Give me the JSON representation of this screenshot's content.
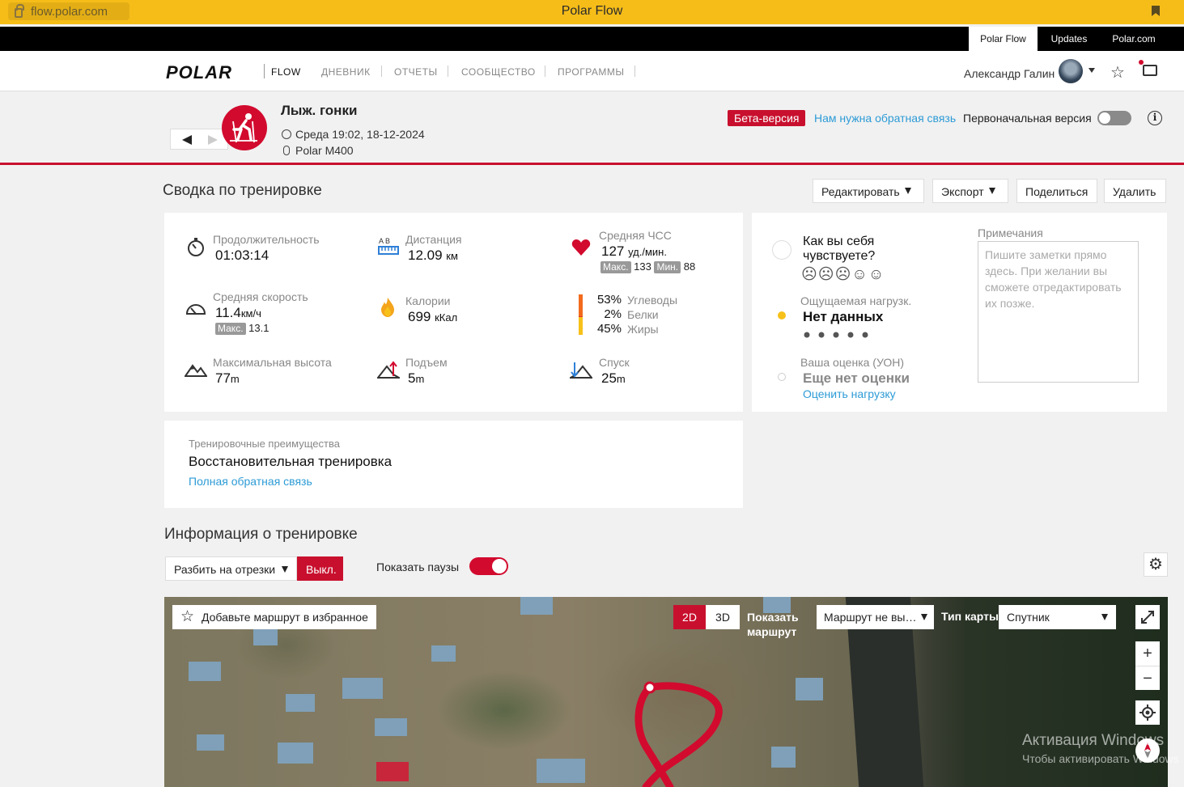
{
  "browser": {
    "url": "flow.polar.com",
    "title": "Polar Flow"
  },
  "topbar": {
    "tabs": [
      "Polar Flow",
      "Updates",
      "Polar.com"
    ]
  },
  "nav": {
    "logo": "POLAR",
    "logo_sub": "FLOW",
    "links": [
      "ДНЕВНИК",
      "ОТЧЕТЫ",
      "СООБЩЕСТВО",
      "ПРОГРАММЫ"
    ],
    "user": "Александр Галин"
  },
  "header": {
    "sport": "Лыж. гонки",
    "datetime": "Среда 19:02, 18-12-2024",
    "device": "Polar M400",
    "beta": "Бета-версия",
    "feedback": "Нам нужна обратная связь",
    "original_version": "Первоначальная версия",
    "info": "i"
  },
  "summary": {
    "title": "Сводка по тренировке",
    "buttons": {
      "edit": "Редактировать",
      "export": "Экспорт",
      "share": "Поделиться",
      "delete": "Удалить"
    },
    "duration": {
      "label": "Продолжительность",
      "value": "01:03:14"
    },
    "distance": {
      "label": "Дистанция",
      "value": "12.09",
      "unit": "км",
      "icon_text": "A B"
    },
    "hr": {
      "label": "Средняя ЧСС",
      "value": "127",
      "unit": "уд./мин.",
      "max_tag": "Макс.",
      "max": "133",
      "min_tag": "Мин.",
      "min": "88"
    },
    "speed": {
      "label": "Средняя скорость",
      "value": "11.4",
      "unit": "км/ч",
      "max_tag": "Макс.",
      "max": "13.1"
    },
    "calories": {
      "label": "Калории",
      "value": "699",
      "unit": "кКал"
    },
    "nutrition": [
      {
        "pct": "53%",
        "name": "Углеводы",
        "fill": 0.53,
        "color": "#f26b1d"
      },
      {
        "pct": "2%",
        "name": "Белки",
        "fill": 0.02,
        "color": "#e03a2e"
      },
      {
        "pct": "45%",
        "name": "Жиры",
        "fill": 0.45,
        "color": "#f7c11a"
      }
    ],
    "altitude": {
      "label": "Максимальная высота",
      "value": "77",
      "unit": "m"
    },
    "ascent": {
      "label": "Подъем",
      "value": "5",
      "unit": "m"
    },
    "descent": {
      "label": "Спуск",
      "value": "25",
      "unit": "m"
    }
  },
  "feeling": {
    "question": "Как вы себя чувствуете?",
    "faces": "☹☹☹☺☺",
    "load_label": "Ощущаемая нагрузк.",
    "load_value": "Нет данных",
    "rating_label": "Ваша оценка (УОН)",
    "rating_value": "Еще нет оценки",
    "rating_link": "Оценить нагрузку",
    "notes_label": "Примечания",
    "notes_placeholder": "Пишите заметки прямо здесь. При желании вы сможете отредактировать их позже."
  },
  "benefit": {
    "label": "Тренировочные преимущества",
    "value": "Восстановительная тренировка",
    "link": "Полная обратная связь"
  },
  "info": {
    "title": "Информация о тренировке",
    "split_label": "Разбить на отрезки",
    "split_state": "Выкл.",
    "pauses_label": "Показать паузы"
  },
  "map": {
    "favorite": "Добавьте маршрут в избранное",
    "view_2d": "2D",
    "view_3d": "3D",
    "show_route": "Показать маршрут",
    "route_select": "Маршрут не вы…",
    "map_type_label": "Тип карты",
    "map_type": "Спутник",
    "zoom_in": "+",
    "zoom_out": "−"
  },
  "watermark": {
    "line1": "Активация Windows",
    "line2": "Чтобы активировать Windows"
  }
}
